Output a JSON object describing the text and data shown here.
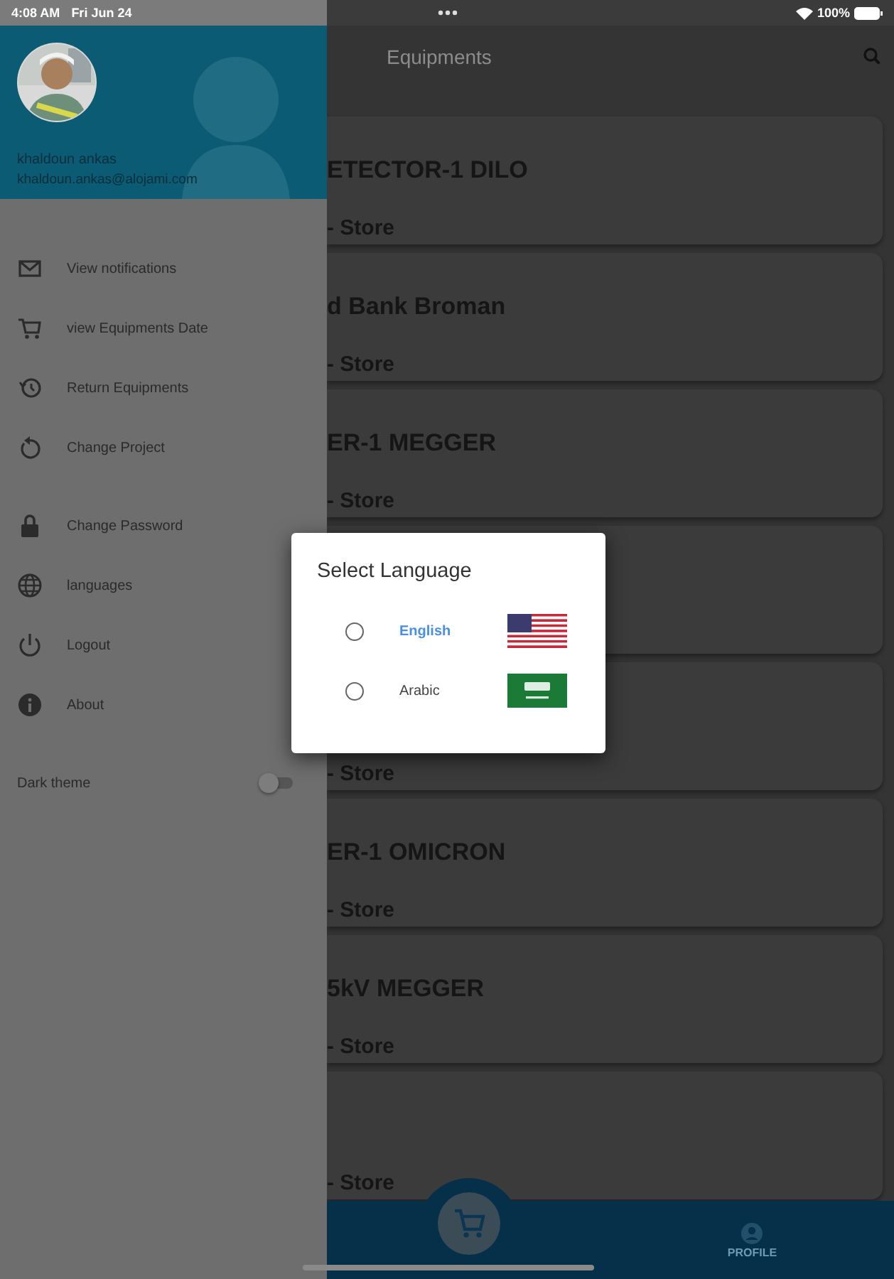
{
  "status_bar": {
    "time": "4:08 AM",
    "date": "Fri Jun 24",
    "battery": "100%"
  },
  "drawer": {
    "user": {
      "name": "khaldoun ankas",
      "email": "khaldoun.ankas@alojami.com"
    },
    "groups": [
      [
        {
          "label": "View notifications"
        },
        {
          "label": "view Equipments Date"
        },
        {
          "label": "Return Equipments"
        },
        {
          "label": "Change Project"
        }
      ],
      [
        {
          "label": "Change Password"
        },
        {
          "label": "languages"
        },
        {
          "label": "Logout"
        },
        {
          "label": "About"
        }
      ]
    ],
    "dark_theme": {
      "label": "Dark theme",
      "on": false
    }
  },
  "app_bar": {
    "title": "Equipments"
  },
  "equipment": [
    {
      "kind": "card",
      "title": "ETECTOR-1 DILO",
      "subtitle": "- Store"
    },
    {
      "kind": "card",
      "title": "d Bank Broman",
      "subtitle": "- Store"
    },
    {
      "kind": "card",
      "title": "ER-1 MEGGER",
      "subtitle": "- Store"
    },
    {
      "kind": "card"
    },
    {
      "kind": "card",
      "subtitle": "- Store"
    },
    {
      "kind": "card",
      "title": "ER-1 OMICRON",
      "subtitle": "- Store"
    },
    {
      "kind": "card",
      "title": "5kV MEGGER",
      "subtitle": "- Store"
    },
    {
      "kind": "card",
      "subtitle": "- Store"
    }
  ],
  "bottom_nav": [
    {
      "kind": "cart",
      "selected": true
    },
    {
      "kind": "profile",
      "label": "PROFILE",
      "selected": false
    }
  ],
  "dialog": {
    "title": "Select Language",
    "options": [
      {
        "label": "English",
        "kind": "us",
        "selected": false,
        "active": true
      },
      {
        "label": "Arabic",
        "kind": "sa",
        "selected": false,
        "active": false
      }
    ]
  }
}
